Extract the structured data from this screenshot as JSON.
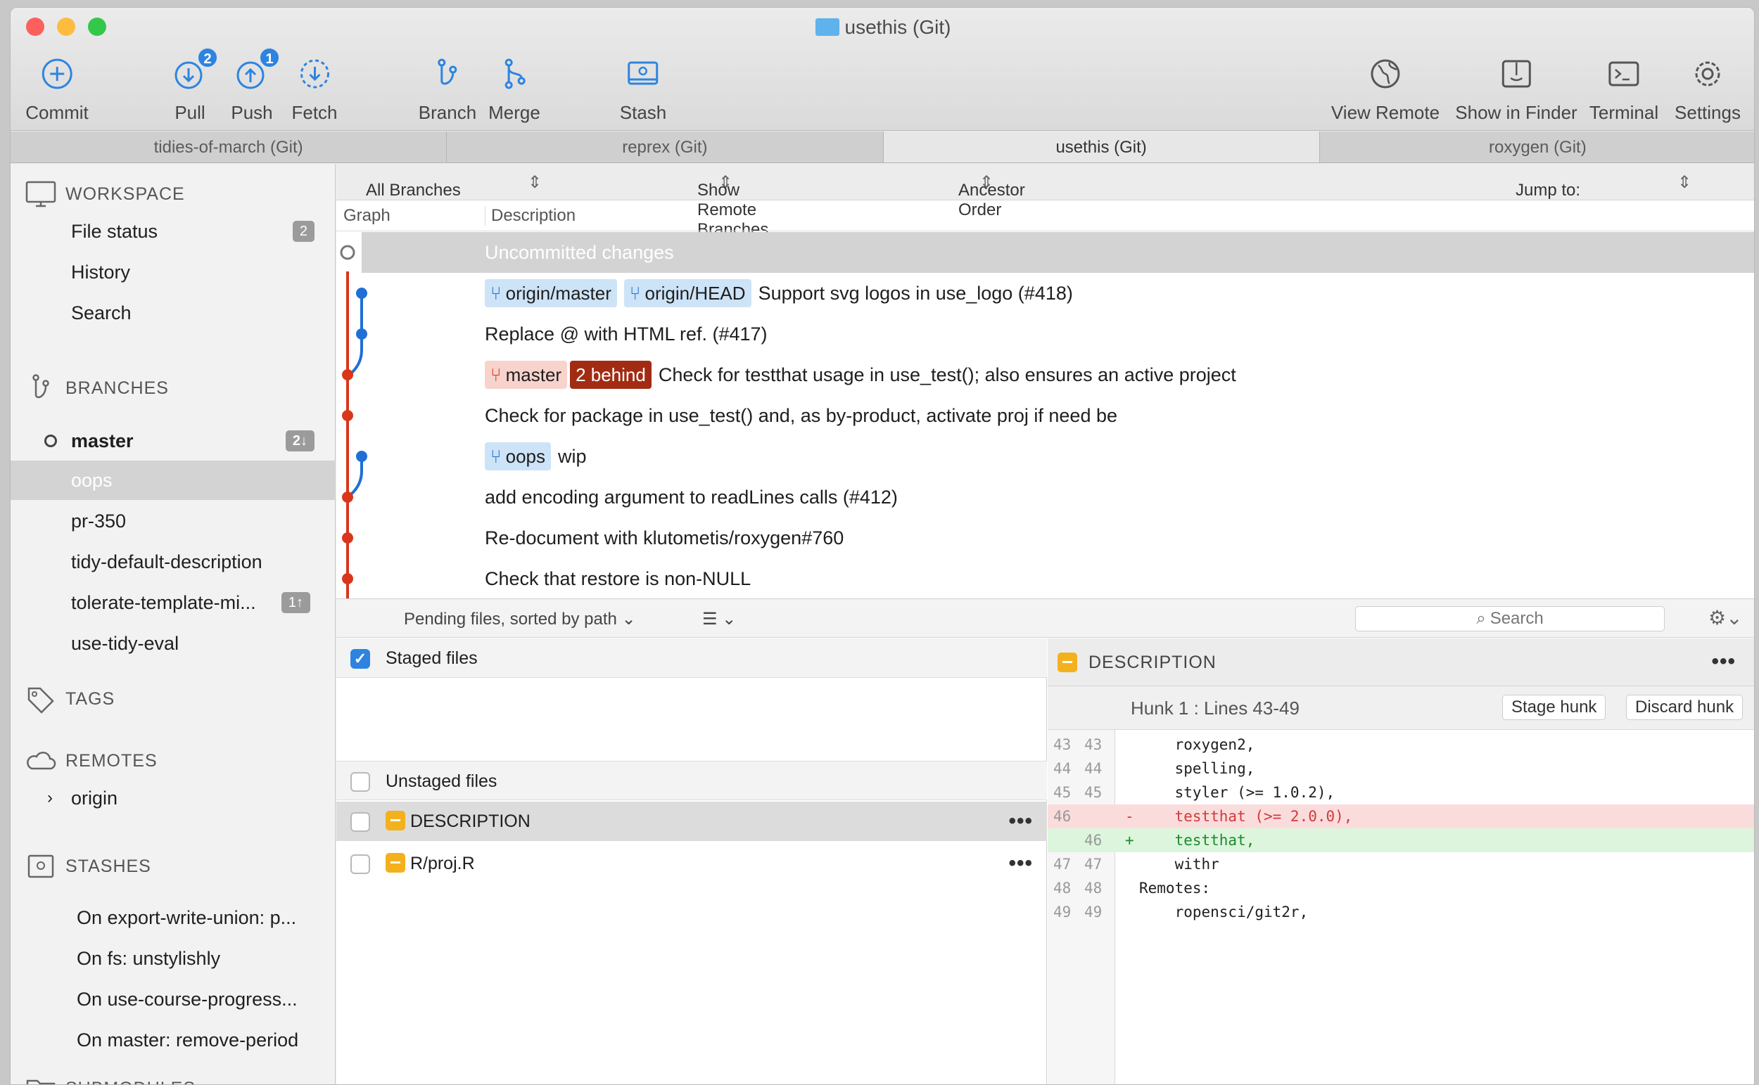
{
  "window": {
    "title": "usethis (Git)"
  },
  "toolbar": {
    "commit": "Commit",
    "pull": "Pull",
    "pull_badge": "2",
    "push": "Push",
    "push_badge": "1",
    "fetch": "Fetch",
    "branch": "Branch",
    "merge": "Merge",
    "stash": "Stash",
    "view_remote": "View Remote",
    "show_in_finder": "Show in Finder",
    "terminal": "Terminal",
    "settings": "Settings"
  },
  "tabs": [
    "tidies-of-march (Git)",
    "reprex (Git)",
    "usethis (Git)",
    "roxygen (Git)"
  ],
  "sidebar": {
    "workspace": "WORKSPACE",
    "file_status": "File status",
    "file_status_count": "2",
    "history": "History",
    "search": "Search",
    "branches": "BRANCHES",
    "master": "master",
    "master_count": "2↓",
    "oops": "oops",
    "pr350": "pr-350",
    "tidy_default": "tidy-default-description",
    "tolerate": "tolerate-template-mi...",
    "tolerate_count": "1↑",
    "use_tidy_eval": "use-tidy-eval",
    "tags": "TAGS",
    "remotes": "REMOTES",
    "origin": "origin",
    "stashes": "STASHES",
    "stash_items": [
      "On export-write-union: p...",
      "On fs: unstylishly",
      "On use-course-progress...",
      "On master: remove-period"
    ],
    "submodules": "SUBMODULES"
  },
  "filters": {
    "branches": "All Branches",
    "remote": "Show Remote Branches",
    "order": "Ancestor Order",
    "jump": "Jump to:"
  },
  "columns": {
    "graph": "Graph",
    "description": "Description"
  },
  "history": {
    "uncommitted": "Uncommitted changes",
    "r1_tag1": "origin/master",
    "r1_tag2": "origin/HEAD",
    "r1_msg": "Support svg logos in use_logo (#418)",
    "r2_msg": "Replace @ with HTML ref. (#417)",
    "r3_tag": "master",
    "r3_behind": "2 behind",
    "r3_msg": "Check for testthat usage in use_test(); also ensures an active project",
    "r4_msg": "Check for package in use_test() and, as by-product, activate proj if need be",
    "r5_tag": "oops",
    "r5_msg": "wip",
    "r6_msg": "add encoding argument to readLines calls (#412)",
    "r7_msg": "Re-document with klutometis/roxygen#760",
    "r8_msg": "Check that restore is non-NULL"
  },
  "pending": {
    "label": "Pending files, sorted by path ⌄",
    "view": "☰ ⌄",
    "search": "Search"
  },
  "files": {
    "staged": "Staged files",
    "unstaged": "Unstaged files",
    "f1": "DESCRIPTION",
    "f2": "R/proj.R",
    "dots": "•••"
  },
  "diff": {
    "file": "DESCRIPTION",
    "dots": "•••",
    "hunk": "Hunk 1 : Lines 43-49",
    "stage": "Stage hunk",
    "discard": "Discard hunk",
    "lines": [
      {
        "o": "43",
        "n": "43",
        "s": "",
        "t": "    roxygen2,"
      },
      {
        "o": "44",
        "n": "44",
        "s": "",
        "t": "    spelling,"
      },
      {
        "o": "45",
        "n": "45",
        "s": "",
        "t": "    styler (>= 1.0.2),"
      },
      {
        "o": "46",
        "n": "",
        "s": "-",
        "t": "    testthat (>= 2.0.0),"
      },
      {
        "o": "",
        "n": "46",
        "s": "+",
        "t": "    testthat,"
      },
      {
        "o": "47",
        "n": "47",
        "s": "",
        "t": "    withr"
      },
      {
        "o": "48",
        "n": "48",
        "s": "",
        "t": "Remotes:"
      },
      {
        "o": "49",
        "n": "49",
        "s": "",
        "t": "    ropensci/git2r,"
      }
    ]
  },
  "colors": {
    "accent": "#2d84e0",
    "graph_blue": "#1f6fd6",
    "graph_red": "#d9361b",
    "behind": "#a12c13"
  }
}
